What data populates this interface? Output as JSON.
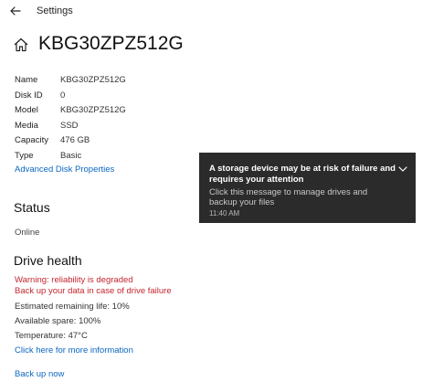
{
  "window": {
    "title": "Settings"
  },
  "page": {
    "title": "KBG30ZPZ512G"
  },
  "properties": [
    {
      "key": "Name",
      "value": "KBG30ZPZ512G"
    },
    {
      "key": "Disk ID",
      "value": "0"
    },
    {
      "key": "Model",
      "value": "KBG30ZPZ512G"
    },
    {
      "key": "Media",
      "value": "SSD"
    },
    {
      "key": "Capacity",
      "value": "476 GB"
    },
    {
      "key": "Type",
      "value": "Basic"
    }
  ],
  "advanced_link": "Advanced Disk Properties",
  "status": {
    "title": "Status",
    "value": "Online"
  },
  "health": {
    "title": "Drive health",
    "warning_line1": "Warning: reliability is degraded",
    "warning_line2": "Back up your data in case of drive failure",
    "remaining_life": "Estimated remaining life: 10%",
    "available_spare": "Available spare: 100%",
    "temperature": "Temperature: 47°C",
    "more_info_link": "Click here for more information",
    "backup_link": "Back up now"
  },
  "toast": {
    "title": "A storage device may be at risk of failure and requires your attention",
    "body": "Click this message to manage drives and backup your files",
    "time": "11:40 AM"
  },
  "colors": {
    "link": "#0b67c2",
    "warning": "#c4262e",
    "toast_background": "#2b2b2b"
  },
  "icons": {
    "back": "back-arrow-icon",
    "home": "home-icon",
    "toast_expand": "chevron-down-icon"
  }
}
